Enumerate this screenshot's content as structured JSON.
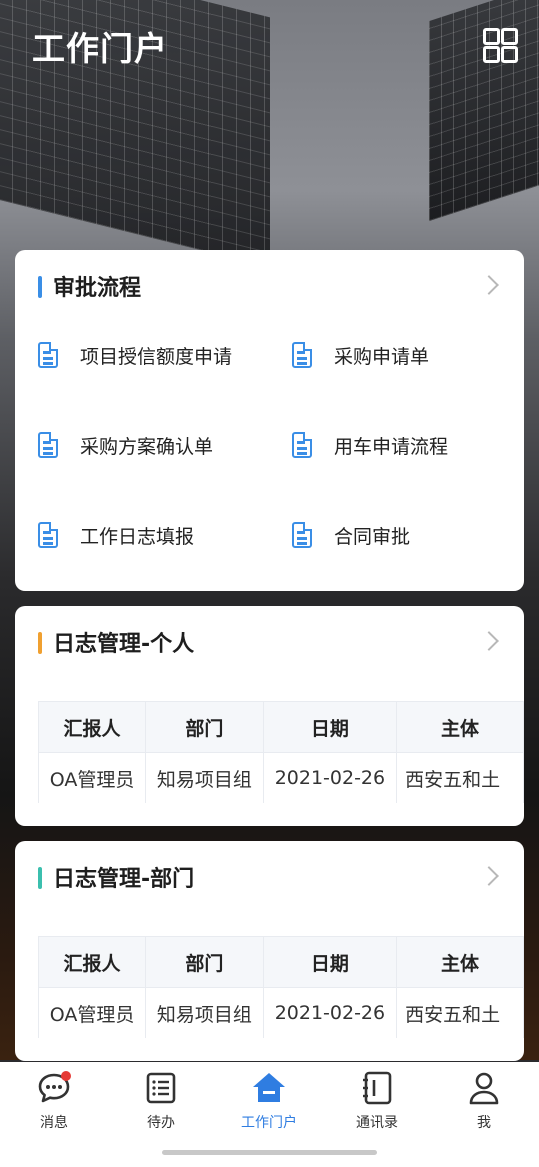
{
  "header": {
    "title": "工作门户",
    "menu_icon": "grid-apps-icon"
  },
  "approval": {
    "title": "审批流程",
    "accent": "#3a8ee6",
    "items": [
      {
        "label": "项目授信额度申请"
      },
      {
        "label": "采购申请单"
      },
      {
        "label": "采购方案确认单"
      },
      {
        "label": "用车申请流程"
      },
      {
        "label": "工作日志填报"
      },
      {
        "label": "合同审批"
      }
    ]
  },
  "log_personal": {
    "title": "日志管理-个人",
    "accent": "#f0a030",
    "columns": [
      "汇报人",
      "部门",
      "日期",
      "主体"
    ],
    "rows": [
      [
        "OA管理员",
        "知易项目组",
        "2021-02-26",
        "西安五和土"
      ]
    ]
  },
  "log_department": {
    "title": "日志管理-部门",
    "accent": "#3bbfae",
    "columns": [
      "汇报人",
      "部门",
      "日期",
      "主体"
    ],
    "rows": [
      [
        "OA管理员",
        "知易项目组",
        "2021-02-26",
        "西安五和土"
      ]
    ]
  },
  "tabbar": {
    "active_color": "#2f7de1",
    "tabs": [
      {
        "label": "消息",
        "icon": "chat-bubble-icon",
        "badge": true
      },
      {
        "label": "待办",
        "icon": "todo-list-icon"
      },
      {
        "label": "工作门户",
        "icon": "home-icon",
        "active": true
      },
      {
        "label": "通讯录",
        "icon": "contacts-book-icon"
      },
      {
        "label": "我",
        "icon": "person-icon"
      }
    ]
  }
}
